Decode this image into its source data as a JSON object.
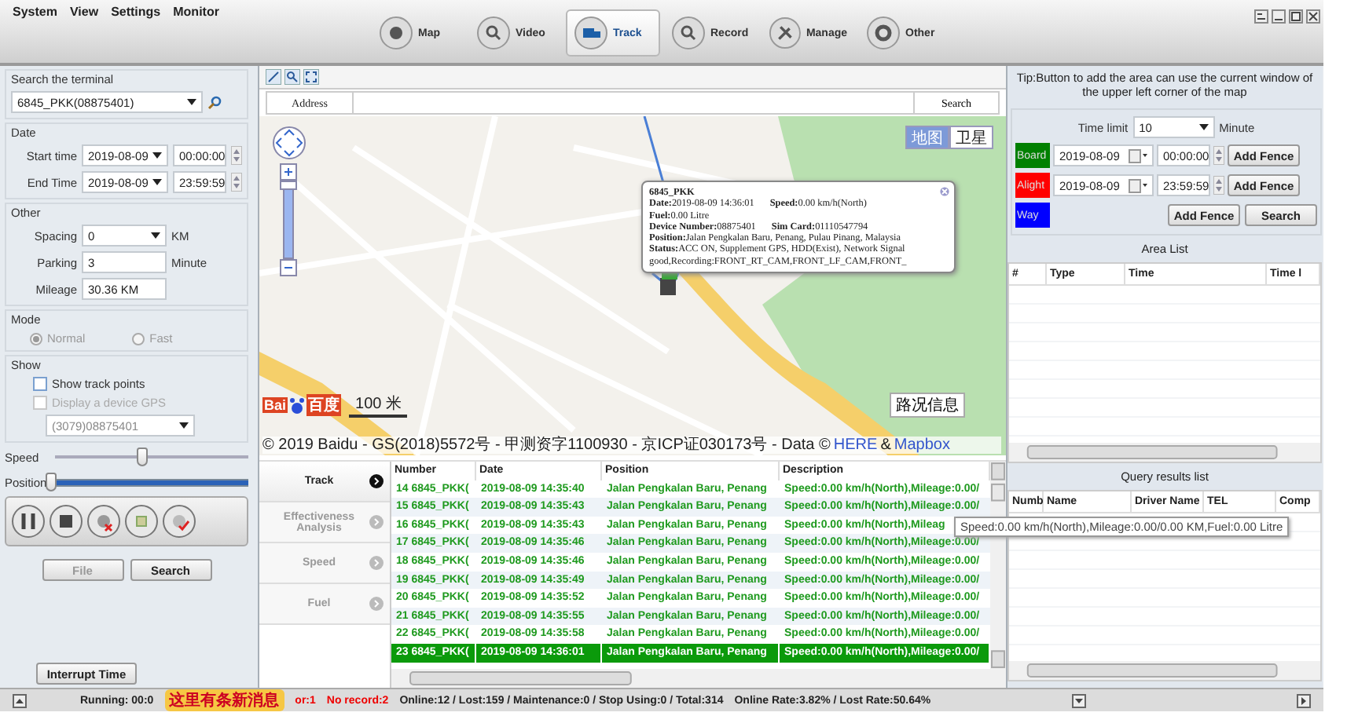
{
  "menu": [
    "System",
    "View",
    "Settings",
    "Monitor"
  ],
  "nav_tabs": [
    {
      "label": "Map",
      "selected": false
    },
    {
      "label": "Video",
      "selected": false
    },
    {
      "label": "Track",
      "selected": true
    },
    {
      "label": "Record",
      "selected": false
    },
    {
      "label": "Manage",
      "selected": false
    },
    {
      "label": "Other",
      "selected": false
    }
  ],
  "left": {
    "search": {
      "title": "Search the terminal",
      "value": "6845_PKK(08875401)"
    },
    "date": {
      "title": "Date",
      "rows": [
        {
          "label": "Start time",
          "date": "2019-08-09",
          "time": "00:00:00"
        },
        {
          "label": "End Time",
          "date": "2019-08-09",
          "time": "23:59:59"
        }
      ]
    },
    "other": {
      "title": "Other",
      "spacing": {
        "label": "Spacing",
        "value": "0",
        "unit": "KM"
      },
      "parking": {
        "label": "Parking",
        "value": "3",
        "unit": "Minute"
      },
      "mileage": {
        "label": "Mileage",
        "value": "30.36 KM"
      }
    },
    "mode": {
      "title": "Mode",
      "options": [
        {
          "label": "Normal",
          "selected": true
        },
        {
          "label": "Fast",
          "selected": false
        }
      ]
    },
    "show": {
      "title": "Show",
      "options": [
        {
          "label": "Show track points",
          "checked": false,
          "disabled": false
        },
        {
          "label": "Display a device GPS",
          "checked": false,
          "disabled": true
        }
      ],
      "device": "(3079)08875401"
    },
    "sliders": [
      {
        "label": "Speed",
        "kind": "plain",
        "level": 0.45
      },
      {
        "label": "Position",
        "kind": "progress",
        "level": 0.02
      }
    ],
    "buttons": [
      {
        "label": "File",
        "disabled": true
      },
      {
        "label": "Search",
        "disabled": false
      }
    ],
    "interrupt_button": "Interrupt Time"
  },
  "map": {
    "address_label": "Address",
    "search_button": "Search",
    "zoom_slider": {
      "level": 0.95
    },
    "map_types": [
      {
        "label": "地图",
        "selected": true
      },
      {
        "label": "卫星",
        "selected": false
      }
    ],
    "popup": {
      "title": "6845_PKK",
      "lines": [
        [
          "**Date:**2019-08-09 14:36:01",
          "**Speed:**0.00 km/h(North)"
        ],
        [
          "**Fuel:**0.00 Litre"
        ],
        [
          "**Device Number:**08875401",
          "**Sim Card:**01110547794"
        ],
        [
          "**Position:**Jalan Pengkalan Baru, Penang, Pulau Pinang, Malaysia"
        ],
        [
          "**Status:**ACC ON, Supplement GPS, HDD(Exist), Network Signal good,Recording:FRONT_RT_CAM,FRONT_LF_CAM,FRONT_"
        ]
      ]
    },
    "logo": [
      "Bai",
      "百度"
    ],
    "scale": "100 米",
    "traffic_button": "路况信息",
    "copyright": "© 2019 Baidu - GS(2018)5572号 - 甲测资字1100930 - 京ICP证030173号 - Data ©",
    "copyright_links": [
      "HERE",
      "Mapbox"
    ],
    "copyright_joiner": "&"
  },
  "bottom_tabs": [
    {
      "label": "Track",
      "selected": true
    },
    {
      "label": "Effectiveness Analysis",
      "selected": false
    },
    {
      "label": "Speed",
      "selected": false
    },
    {
      "label": "Fuel",
      "selected": false
    }
  ],
  "table": {
    "columns": [
      "Number",
      "Date",
      "Position",
      "Description"
    ],
    "rows": [
      {
        "cells": [
          "14 6845_PKK(",
          "2019-08-09 14:35:40",
          "Jalan Pengkalan Baru, Penang",
          "Speed:0.00 km/h(North),Mileage:0.00/"
        ],
        "selected": false
      },
      {
        "cells": [
          "15 6845_PKK(",
          "2019-08-09 14:35:43",
          "Jalan Pengkalan Baru, Penang",
          "Speed:0.00 km/h(North),Mileage:0.00/"
        ],
        "selected": false
      },
      {
        "cells": [
          "16 6845_PKK(",
          "2019-08-09 14:35:43",
          "Jalan Pengkalan Baru, Penang",
          "Speed:0.00 km/h(North),Mileag"
        ],
        "selected": false
      },
      {
        "cells": [
          "17 6845_PKK(",
          "2019-08-09 14:35:46",
          "Jalan Pengkalan Baru, Penang",
          "Speed:0.00 km/h(North),Mileage:0.00/"
        ],
        "selected": false
      },
      {
        "cells": [
          "18 6845_PKK(",
          "2019-08-09 14:35:46",
          "Jalan Pengkalan Baru, Penang",
          "Speed:0.00 km/h(North),Mileage:0.00/"
        ],
        "selected": false
      },
      {
        "cells": [
          "19 6845_PKK(",
          "2019-08-09 14:35:49",
          "Jalan Pengkalan Baru, Penang",
          "Speed:0.00 km/h(North),Mileage:0.00/"
        ],
        "selected": false
      },
      {
        "cells": [
          "20 6845_PKK(",
          "2019-08-09 14:35:52",
          "Jalan Pengkalan Baru, Penang",
          "Speed:0.00 km/h(North),Mileage:0.00/"
        ],
        "selected": false
      },
      {
        "cells": [
          "21 6845_PKK(",
          "2019-08-09 14:35:55",
          "Jalan Pengkalan Baru, Penang",
          "Speed:0.00 km/h(North),Mileage:0.00/"
        ],
        "selected": false
      },
      {
        "cells": [
          "22 6845_PKK(",
          "2019-08-09 14:35:58",
          "Jalan Pengkalan Baru, Penang",
          "Speed:0.00 km/h(North),Mileage:0.00/"
        ],
        "selected": false
      },
      {
        "cells": [
          "23 6845_PKK(",
          "2019-08-09 14:36:01",
          "Jalan Pengkalan Baru, Penang",
          "Speed:0.00 km/h(North),Mileage:0.00/"
        ],
        "selected": true
      }
    ],
    "tooltip": "Speed:0.00 km/h(North),Mileage:0.00/0.00 KM,Fuel:0.00 Litre"
  },
  "right": {
    "tip": "Tip:Button to add the area can use the current window of the upper left corner of the map",
    "time_limit": {
      "label": "Time limit",
      "value": "10",
      "unit": "Minute"
    },
    "fences": [
      {
        "label": "Board",
        "color": "#008000",
        "date": "2019-08-09",
        "time": "00:00:00",
        "button": "Add Fence"
      },
      {
        "label": "Alight",
        "color": "#ff0000",
        "date": "2019-08-09",
        "time": "23:59:59",
        "button": "Add Fence"
      },
      {
        "label": "Way",
        "color": "#0000ff"
      }
    ],
    "fence_buttons": [
      "Add Fence",
      "Search"
    ],
    "area_list": {
      "title": "Area List",
      "columns": [
        "#",
        "Type",
        "Time",
        "Time l"
      ]
    },
    "query_results": {
      "title": "Query results list",
      "columns": [
        "Numb",
        "Name",
        "Driver Name",
        "TEL",
        "Comp"
      ]
    }
  },
  "status": {
    "running": "Running: 00:0",
    "notice": "这里有条新消息",
    "error": "or:1",
    "no_record": "No record:2",
    "counts": "Online:12 / Lost:159 / Maintenance:0 / Stop Using:0 / Total:314",
    "rates": "Online Rate:3.82% / Lost Rate:50.64%"
  }
}
